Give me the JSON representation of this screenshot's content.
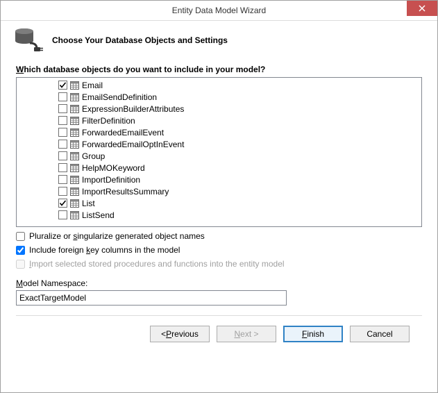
{
  "title": "Entity Data Model Wizard",
  "header": "Choose Your Database Objects and Settings",
  "prompt": "Which database objects do you want to include in your model?",
  "tree": {
    "items": [
      {
        "label": "Email",
        "checked": true
      },
      {
        "label": "EmailSendDefinition",
        "checked": false
      },
      {
        "label": "ExpressionBuilderAttributes",
        "checked": false
      },
      {
        "label": "FilterDefinition",
        "checked": false
      },
      {
        "label": "ForwardedEmailEvent",
        "checked": false
      },
      {
        "label": "ForwardedEmailOptInEvent",
        "checked": false
      },
      {
        "label": "Group",
        "checked": false
      },
      {
        "label": "HelpMOKeyword",
        "checked": false
      },
      {
        "label": "ImportDefinition",
        "checked": false
      },
      {
        "label": "ImportResultsSummary",
        "checked": false
      },
      {
        "label": "List",
        "checked": true
      },
      {
        "label": "ListSend",
        "checked": false
      }
    ]
  },
  "options": {
    "pluralize": {
      "label": "Pluralize or singularize generated object names",
      "checked": false,
      "enabled": true
    },
    "fk": {
      "label": "Include foreign key columns in the model",
      "checked": true,
      "enabled": true
    },
    "sp": {
      "label": "Import selected stored procedures and functions into the entity model",
      "checked": false,
      "enabled": false
    }
  },
  "namespace": {
    "label": "Model Namespace:",
    "value": "ExactTargetModel"
  },
  "buttons": {
    "previous": "< Previous",
    "next": "Next >",
    "finish": "Finish",
    "cancel": "Cancel"
  }
}
